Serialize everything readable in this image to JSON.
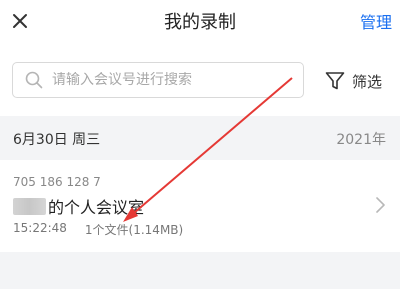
{
  "header": {
    "close_icon": "close-icon",
    "title": "我的录制",
    "manage_label": "管理",
    "accent_color": "#1a6ff0"
  },
  "search": {
    "placeholder": "请输入会议号进行搜索",
    "value": "",
    "icon": "search-icon"
  },
  "filter": {
    "label": "筛选",
    "icon": "filter-icon"
  },
  "section": {
    "date": "6月30日 周三",
    "year": "2021年"
  },
  "records": [
    {
      "meeting_id": "705 186 128 7",
      "name": "的个人会议室",
      "time": "15:22:48",
      "files": "1个文件(1.14MB)"
    }
  ],
  "annotation": {
    "type": "arrow",
    "color": "#e53935"
  }
}
